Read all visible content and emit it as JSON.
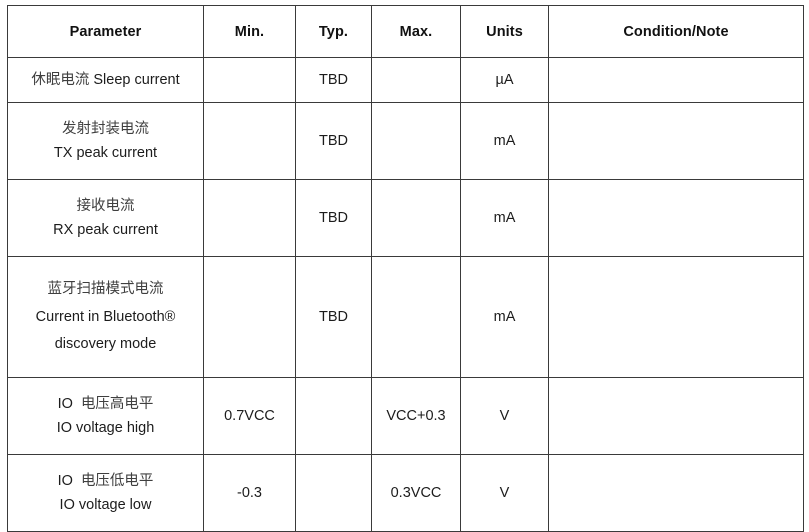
{
  "table": {
    "name": "electrical-characteristics-table",
    "columns": [
      {
        "key": "parameter",
        "label": "Parameter"
      },
      {
        "key": "min",
        "label": "Min."
      },
      {
        "key": "typ",
        "label": "Typ."
      },
      {
        "key": "max",
        "label": "Max."
      },
      {
        "key": "units",
        "label": "Units"
      },
      {
        "key": "note",
        "label": "Condition/Note"
      }
    ],
    "rows": [
      {
        "parameter_lines": [
          {
            "cjk": "休眠电流",
            "latin": "Sleep current",
            "inline": true
          }
        ],
        "min": "",
        "typ": "TBD",
        "max": "",
        "units": "µA",
        "note": ""
      },
      {
        "parameter_lines": [
          {
            "cjk": "发射封装电流",
            "latin": "",
            "inline": false
          },
          {
            "cjk": "",
            "latin": "TX peak current",
            "inline": false
          }
        ],
        "min": "",
        "typ": "TBD",
        "max": "",
        "units": "mA",
        "note": ""
      },
      {
        "parameter_lines": [
          {
            "cjk": "接收电流",
            "latin": "",
            "inline": false
          },
          {
            "cjk": "",
            "latin": "RX peak current",
            "inline": false
          }
        ],
        "min": "",
        "typ": "TBD",
        "max": "",
        "units": "mA",
        "note": ""
      },
      {
        "parameter_lines": [
          {
            "cjk": "蓝牙扫描模式电流",
            "latin": "",
            "inline": false
          },
          {
            "cjk": "",
            "latin": "Current in Bluetooth®",
            "inline": false
          },
          {
            "cjk": "",
            "latin": "discovery mode",
            "inline": false
          }
        ],
        "min": "",
        "typ": "TBD",
        "max": "",
        "units": "mA",
        "note": ""
      },
      {
        "parameter_lines": [
          {
            "cjk": "电压高电平",
            "latin": "IO",
            "inline": true,
            "latin_first": true
          },
          {
            "cjk": "",
            "latin": "IO voltage high",
            "inline": false
          }
        ],
        "min": "0.7VCC",
        "typ": "",
        "max": "VCC+0.3",
        "units": "V",
        "note": ""
      },
      {
        "parameter_lines": [
          {
            "cjk": "电压低电平",
            "latin": "IO",
            "inline": true,
            "latin_first": true
          },
          {
            "cjk": "",
            "latin": "IO voltage low",
            "inline": false
          }
        ],
        "min": "-0.3",
        "typ": "",
        "max": "0.3VCC",
        "units": "V",
        "note": ""
      }
    ]
  },
  "colors": {
    "header_background": "#c9c9c9",
    "border": "#3a3a3a",
    "text": "#1c1c1c",
    "cjk_text": "#3f3f3f",
    "page_background": "#ffffff"
  }
}
